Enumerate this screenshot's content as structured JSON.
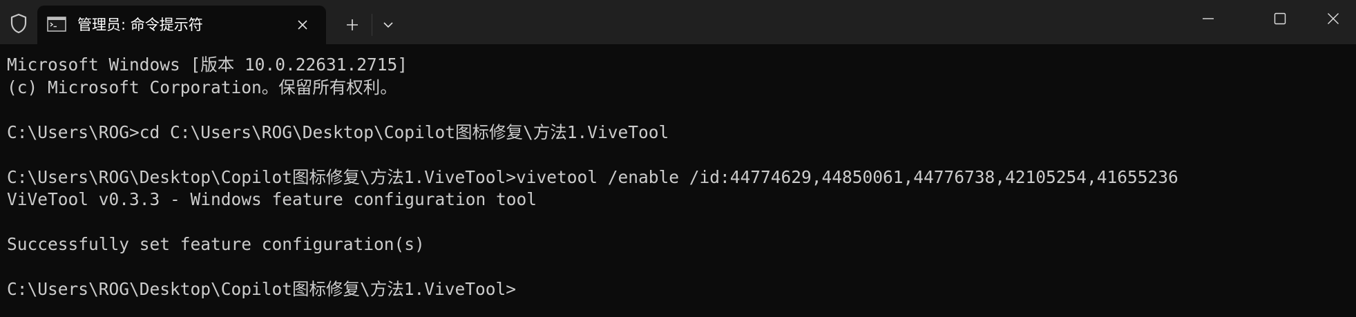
{
  "window": {
    "tab_title": "管理员: 命令提示符"
  },
  "icons": {
    "shield": "shield-icon",
    "cmd": "cmd-icon",
    "close_tab": "close-icon",
    "new_tab": "plus-icon",
    "dropdown": "chevron-down-icon",
    "minimize": "minimize-icon",
    "maximize": "maximize-icon",
    "close_window": "close-icon"
  },
  "colors": {
    "titlebar": "#202020",
    "background": "#0c0c0c",
    "text": "#cccccc"
  },
  "terminal": {
    "lines": [
      "Microsoft Windows [版本 10.0.22631.2715]",
      "(c) Microsoft Corporation。保留所有权利。",
      "",
      "C:\\Users\\ROG>cd C:\\Users\\ROG\\Desktop\\Copilot图标修复\\方法1.ViveTool",
      "",
      "C:\\Users\\ROG\\Desktop\\Copilot图标修复\\方法1.ViveTool>vivetool /enable /id:44774629,44850061,44776738,42105254,41655236",
      "ViVeTool v0.3.3 - Windows feature configuration tool",
      "",
      "Successfully set feature configuration(s)",
      "",
      "C:\\Users\\ROG\\Desktop\\Copilot图标修复\\方法1.ViveTool>"
    ]
  }
}
